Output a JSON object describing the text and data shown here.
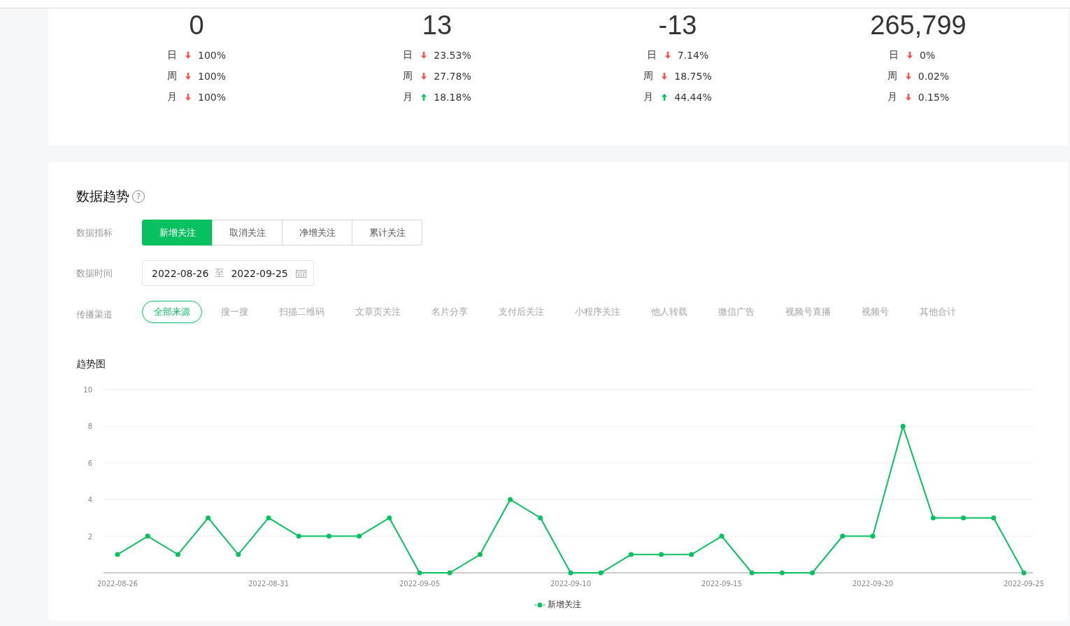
{
  "stats": [
    {
      "value": "0",
      "changes": [
        {
          "period": "日",
          "kind": "down",
          "change": "100%"
        },
        {
          "period": "周",
          "kind": "down",
          "change": "100%"
        },
        {
          "period": "月",
          "kind": "down",
          "change": "100%"
        }
      ]
    },
    {
      "value": "13",
      "changes": [
        {
          "period": "日",
          "kind": "down",
          "change": "23.53%"
        },
        {
          "period": "周",
          "kind": "down",
          "change": "27.78%"
        },
        {
          "period": "月",
          "kind": "up",
          "change": "18.18%"
        }
      ]
    },
    {
      "value": "-13",
      "changes": [
        {
          "period": "日",
          "kind": "down",
          "change": "7.14%"
        },
        {
          "period": "周",
          "kind": "down",
          "change": "18.75%"
        },
        {
          "period": "月",
          "kind": "up",
          "change": "44.44%"
        }
      ]
    },
    {
      "value": "265,799",
      "changes": [
        {
          "period": "日",
          "kind": "down",
          "change": "0%"
        },
        {
          "period": "周",
          "kind": "down",
          "change": "0.02%"
        },
        {
          "period": "月",
          "kind": "down",
          "change": "0.15%"
        }
      ]
    }
  ],
  "trend": {
    "title": "数据趋势",
    "help_icon": "?",
    "metric_label": "数据指标",
    "metrics": [
      {
        "label": "新增关注",
        "selected": true
      },
      {
        "label": "取消关注",
        "selected": false
      },
      {
        "label": "净增关注",
        "selected": false
      },
      {
        "label": "累计关注",
        "selected": false
      }
    ],
    "time_label": "数据时间",
    "date_range": {
      "start": "2022-08-26",
      "separator": "至",
      "end": "2022-09-25"
    },
    "channel_label": "传播渠道",
    "channels": [
      {
        "label": "全部来源",
        "selected": true
      },
      {
        "label": "搜一搜",
        "selected": false
      },
      {
        "label": "扫描二维码",
        "selected": false
      },
      {
        "label": "文章页关注",
        "selected": false
      },
      {
        "label": "名片分享",
        "selected": false
      },
      {
        "label": "支付后关注",
        "selected": false
      },
      {
        "label": "小程序关注",
        "selected": false
      },
      {
        "label": "他人转载",
        "selected": false
      },
      {
        "label": "微信广告",
        "selected": false
      },
      {
        "label": "视频号直播",
        "selected": false
      },
      {
        "label": "视频号",
        "selected": false
      },
      {
        "label": "其他合计",
        "selected": false
      }
    ],
    "chart_title": "趋势图",
    "chart_data": {
      "type": "line",
      "categories": [
        "2022-08-26",
        null,
        null,
        null,
        null,
        "2022-08-31",
        null,
        null,
        null,
        null,
        "2022-09-05",
        null,
        null,
        null,
        null,
        "2022-09-10",
        null,
        null,
        null,
        null,
        "2022-09-15",
        null,
        null,
        null,
        null,
        "2022-09-20",
        null,
        null,
        null,
        null,
        "2022-09-25"
      ],
      "ylim": [
        0,
        10
      ],
      "yticks": [
        2,
        4,
        6,
        8,
        10
      ],
      "grid": true,
      "series": [
        {
          "name": "新增关注",
          "color": "#07c160",
          "marker": true,
          "values": [
            1,
            2,
            1,
            3,
            1,
            3,
            2,
            2,
            2,
            3,
            0,
            0,
            1,
            4,
            3,
            0,
            0,
            1,
            1,
            1,
            2,
            0,
            0,
            0,
            2,
            2,
            8,
            3,
            3,
            3,
            0
          ]
        }
      ]
    }
  }
}
